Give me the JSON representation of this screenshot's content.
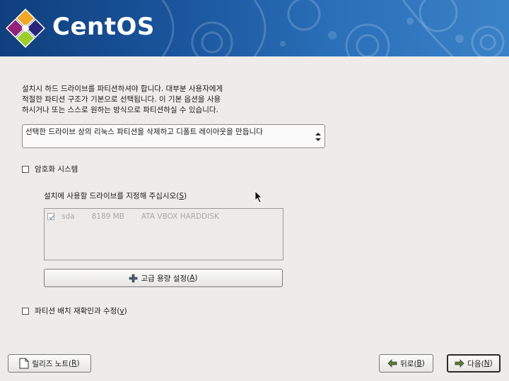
{
  "header": {
    "logo_text": "CentOS",
    "logo_icon": "centos-logo-icon"
  },
  "description_lines": [
    "설치시 하드 드라이브를 파티션하셔야 합니다. 대부분 사용자에게",
    "적절한 파티션 구조가 기본으로 선택됩니다. 이 기본 옵션을 사용",
    "하시거나 또는 스스로 원하는 방식으로 파티션하실 수 있습니다."
  ],
  "partition_combo": {
    "selected": "선택한 드라이브 상의 리눅스 파티션을 삭제하고 디폴트 레이아웃을 만듭니다"
  },
  "encrypt": {
    "label": "암호화 시스템",
    "checked": false
  },
  "drive_select": {
    "label_prefix": "설치에 사용할 드라이브를 지정해 주십시오(",
    "mnemonic": "S",
    "label_suffix": ")",
    "drives": [
      {
        "checked": true,
        "name": "sda",
        "size": "8189 MB",
        "model": "ATA VBOX HARDDISK"
      }
    ]
  },
  "advanced_button": {
    "label_prefix": "고급 용량 설정(",
    "mnemonic": "A",
    "label_suffix": ")",
    "icon": "plus-icon"
  },
  "review": {
    "label_prefix": "파티션 배치 재확인과 수정(",
    "mnemonic": "v",
    "label_suffix": ")",
    "checked": false
  },
  "footer": {
    "release_notes": {
      "prefix": "릴리즈 노트(",
      "mnemonic": "R",
      "suffix": ")",
      "icon": "document-icon"
    },
    "back": {
      "prefix": "뒤로(",
      "mnemonic": "B",
      "suffix": ")",
      "icon": "arrow-left-icon"
    },
    "next": {
      "prefix": "다음(",
      "mnemonic": "N",
      "suffix": ")",
      "icon": "arrow-right-icon"
    }
  }
}
